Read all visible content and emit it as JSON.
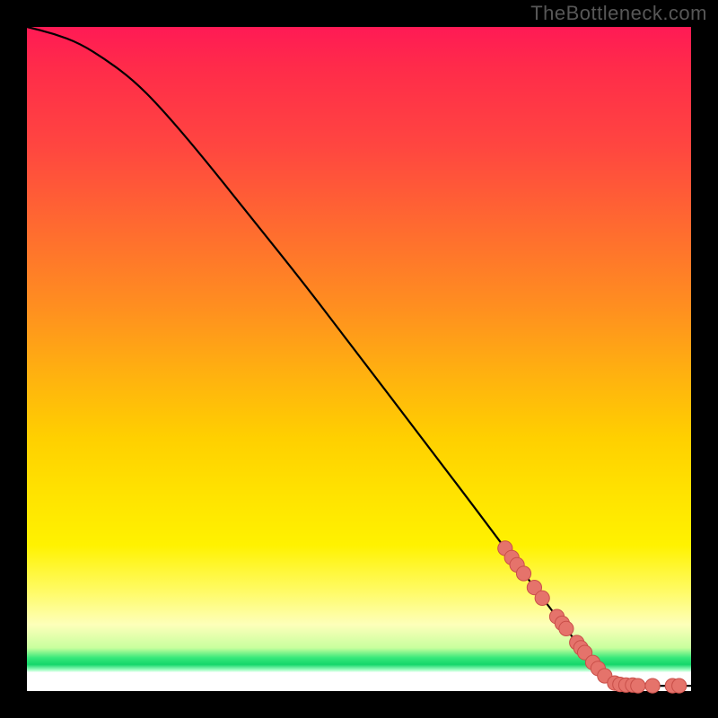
{
  "watermark": "TheBottleneck.com",
  "colors": {
    "curve": "#000000",
    "marker_fill": "#e5736b",
    "marker_stroke": "#c94f49"
  },
  "chart_data": {
    "type": "line",
    "title": "",
    "xlabel": "",
    "ylabel": "",
    "xlim": [
      0,
      100
    ],
    "ylim": [
      0,
      100
    ],
    "grid": false,
    "curve": [
      {
        "x": 0,
        "y": 100
      },
      {
        "x": 4,
        "y": 99
      },
      {
        "x": 8,
        "y": 97.5
      },
      {
        "x": 12,
        "y": 95
      },
      {
        "x": 16,
        "y": 92
      },
      {
        "x": 20,
        "y": 88
      },
      {
        "x": 26,
        "y": 81
      },
      {
        "x": 34,
        "y": 71
      },
      {
        "x": 42,
        "y": 61
      },
      {
        "x": 50,
        "y": 50.5
      },
      {
        "x": 58,
        "y": 40
      },
      {
        "x": 66,
        "y": 29.5
      },
      {
        "x": 72,
        "y": 21.5
      },
      {
        "x": 78,
        "y": 13.5
      },
      {
        "x": 83,
        "y": 7
      },
      {
        "x": 86.5,
        "y": 3
      },
      {
        "x": 88,
        "y": 1.4
      },
      {
        "x": 90,
        "y": 0.9
      },
      {
        "x": 93,
        "y": 0.8
      },
      {
        "x": 96,
        "y": 0.8
      },
      {
        "x": 100,
        "y": 0.8
      }
    ],
    "markers": [
      {
        "x": 72.0,
        "y": 21.5
      },
      {
        "x": 73.0,
        "y": 20.1
      },
      {
        "x": 73.8,
        "y": 19.0
      },
      {
        "x": 74.8,
        "y": 17.7
      },
      {
        "x": 76.4,
        "y": 15.6
      },
      {
        "x": 77.6,
        "y": 14.0
      },
      {
        "x": 79.8,
        "y": 11.2
      },
      {
        "x": 80.6,
        "y": 10.2
      },
      {
        "x": 81.2,
        "y": 9.4
      },
      {
        "x": 82.8,
        "y": 7.3
      },
      {
        "x": 83.4,
        "y": 6.5
      },
      {
        "x": 84.0,
        "y": 5.8
      },
      {
        "x": 85.2,
        "y": 4.3
      },
      {
        "x": 86.0,
        "y": 3.4
      },
      {
        "x": 87.0,
        "y": 2.3
      },
      {
        "x": 88.5,
        "y": 1.2
      },
      {
        "x": 89.3,
        "y": 1.0
      },
      {
        "x": 90.2,
        "y": 0.9
      },
      {
        "x": 91.2,
        "y": 0.9
      },
      {
        "x": 92.0,
        "y": 0.8
      },
      {
        "x": 94.2,
        "y": 0.8
      },
      {
        "x": 97.2,
        "y": 0.8
      },
      {
        "x": 98.2,
        "y": 0.8
      }
    ],
    "marker_radius": 1.1
  }
}
